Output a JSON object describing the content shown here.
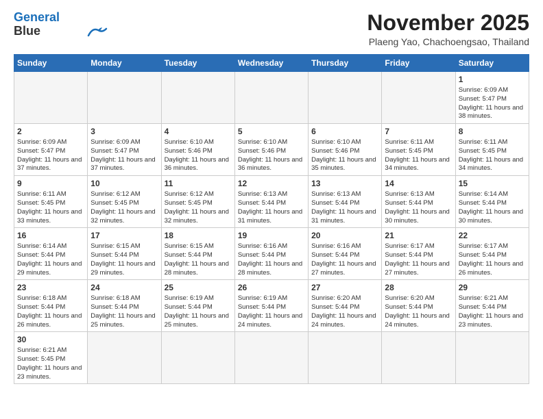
{
  "header": {
    "logo_line1": "General",
    "logo_line2": "Blue",
    "month": "November 2025",
    "location": "Plaeng Yao, Chachoengsao, Thailand"
  },
  "days_of_week": [
    "Sunday",
    "Monday",
    "Tuesday",
    "Wednesday",
    "Thursday",
    "Friday",
    "Saturday"
  ],
  "weeks": [
    [
      {
        "day": "",
        "empty": true
      },
      {
        "day": "",
        "empty": true
      },
      {
        "day": "",
        "empty": true
      },
      {
        "day": "",
        "empty": true
      },
      {
        "day": "",
        "empty": true
      },
      {
        "day": "",
        "empty": true
      },
      {
        "day": "1",
        "sunrise": "6:09 AM",
        "sunset": "5:47 PM",
        "daylight": "11 hours and 38 minutes."
      }
    ],
    [
      {
        "day": "2",
        "sunrise": "6:09 AM",
        "sunset": "5:47 PM",
        "daylight": "11 hours and 37 minutes."
      },
      {
        "day": "3",
        "sunrise": "6:09 AM",
        "sunset": "5:47 PM",
        "daylight": "11 hours and 37 minutes."
      },
      {
        "day": "4",
        "sunrise": "6:10 AM",
        "sunset": "5:46 PM",
        "daylight": "11 hours and 36 minutes."
      },
      {
        "day": "5",
        "sunrise": "6:10 AM",
        "sunset": "5:46 PM",
        "daylight": "11 hours and 36 minutes."
      },
      {
        "day": "6",
        "sunrise": "6:10 AM",
        "sunset": "5:46 PM",
        "daylight": "11 hours and 35 minutes."
      },
      {
        "day": "7",
        "sunrise": "6:11 AM",
        "sunset": "5:45 PM",
        "daylight": "11 hours and 34 minutes."
      },
      {
        "day": "8",
        "sunrise": "6:11 AM",
        "sunset": "5:45 PM",
        "daylight": "11 hours and 34 minutes."
      }
    ],
    [
      {
        "day": "9",
        "sunrise": "6:11 AM",
        "sunset": "5:45 PM",
        "daylight": "11 hours and 33 minutes."
      },
      {
        "day": "10",
        "sunrise": "6:12 AM",
        "sunset": "5:45 PM",
        "daylight": "11 hours and 32 minutes."
      },
      {
        "day": "11",
        "sunrise": "6:12 AM",
        "sunset": "5:45 PM",
        "daylight": "11 hours and 32 minutes."
      },
      {
        "day": "12",
        "sunrise": "6:13 AM",
        "sunset": "5:44 PM",
        "daylight": "11 hours and 31 minutes."
      },
      {
        "day": "13",
        "sunrise": "6:13 AM",
        "sunset": "5:44 PM",
        "daylight": "11 hours and 31 minutes."
      },
      {
        "day": "14",
        "sunrise": "6:13 AM",
        "sunset": "5:44 PM",
        "daylight": "11 hours and 30 minutes."
      },
      {
        "day": "15",
        "sunrise": "6:14 AM",
        "sunset": "5:44 PM",
        "daylight": "11 hours and 30 minutes."
      }
    ],
    [
      {
        "day": "16",
        "sunrise": "6:14 AM",
        "sunset": "5:44 PM",
        "daylight": "11 hours and 29 minutes."
      },
      {
        "day": "17",
        "sunrise": "6:15 AM",
        "sunset": "5:44 PM",
        "daylight": "11 hours and 29 minutes."
      },
      {
        "day": "18",
        "sunrise": "6:15 AM",
        "sunset": "5:44 PM",
        "daylight": "11 hours and 28 minutes."
      },
      {
        "day": "19",
        "sunrise": "6:16 AM",
        "sunset": "5:44 PM",
        "daylight": "11 hours and 28 minutes."
      },
      {
        "day": "20",
        "sunrise": "6:16 AM",
        "sunset": "5:44 PM",
        "daylight": "11 hours and 27 minutes."
      },
      {
        "day": "21",
        "sunrise": "6:17 AM",
        "sunset": "5:44 PM",
        "daylight": "11 hours and 27 minutes."
      },
      {
        "day": "22",
        "sunrise": "6:17 AM",
        "sunset": "5:44 PM",
        "daylight": "11 hours and 26 minutes."
      }
    ],
    [
      {
        "day": "23",
        "sunrise": "6:18 AM",
        "sunset": "5:44 PM",
        "daylight": "11 hours and 26 minutes."
      },
      {
        "day": "24",
        "sunrise": "6:18 AM",
        "sunset": "5:44 PM",
        "daylight": "11 hours and 25 minutes."
      },
      {
        "day": "25",
        "sunrise": "6:19 AM",
        "sunset": "5:44 PM",
        "daylight": "11 hours and 25 minutes."
      },
      {
        "day": "26",
        "sunrise": "6:19 AM",
        "sunset": "5:44 PM",
        "daylight": "11 hours and 24 minutes."
      },
      {
        "day": "27",
        "sunrise": "6:20 AM",
        "sunset": "5:44 PM",
        "daylight": "11 hours and 24 minutes."
      },
      {
        "day": "28",
        "sunrise": "6:20 AM",
        "sunset": "5:44 PM",
        "daylight": "11 hours and 24 minutes."
      },
      {
        "day": "29",
        "sunrise": "6:21 AM",
        "sunset": "5:44 PM",
        "daylight": "11 hours and 23 minutes."
      }
    ],
    [
      {
        "day": "30",
        "sunrise": "6:21 AM",
        "sunset": "5:45 PM",
        "daylight": "11 hours and 23 minutes."
      },
      {
        "day": "",
        "empty": true
      },
      {
        "day": "",
        "empty": true
      },
      {
        "day": "",
        "empty": true
      },
      {
        "day": "",
        "empty": true
      },
      {
        "day": "",
        "empty": true
      },
      {
        "day": "",
        "empty": true
      }
    ]
  ]
}
